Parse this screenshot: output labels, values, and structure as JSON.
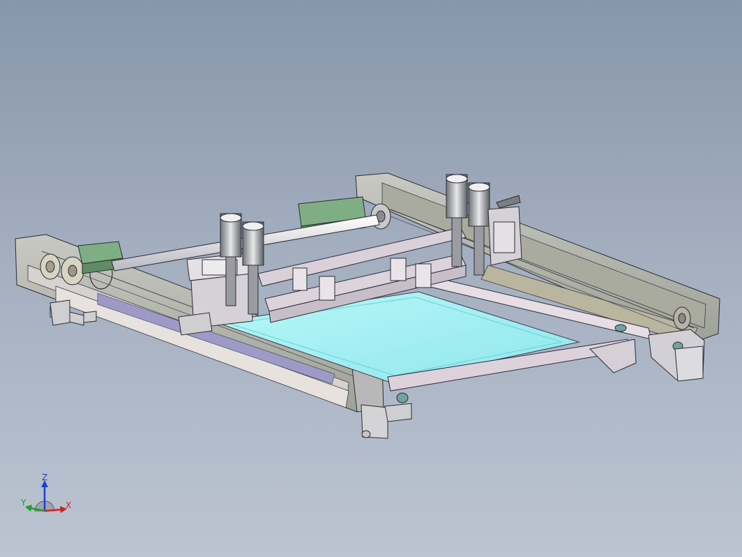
{
  "viewport": {
    "background_top": "#8796ab",
    "background_bottom": "#bcc4d1"
  },
  "model": {
    "description_colors": {
      "frame": "#c9c3c8",
      "screen_glass": "#9ff0f2",
      "motor_green": "#7fae84",
      "rod": "#e9e9ee",
      "outline": "#2b2b33"
    }
  },
  "triad": {
    "z_label": "Z",
    "y_label": "Y",
    "x_label": "X",
    "z_color": "#1f3fd0",
    "y_color": "#1aa02a",
    "x_color": "#d0201f"
  }
}
